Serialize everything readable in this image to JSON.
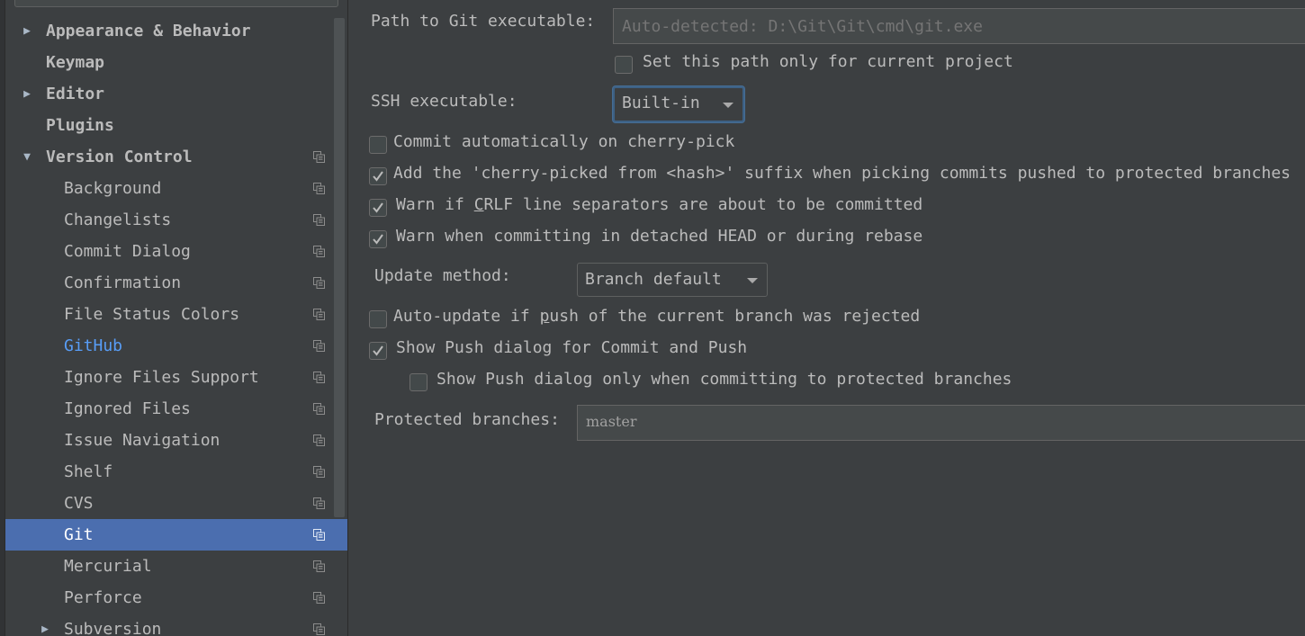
{
  "sidebar": {
    "items": [
      {
        "label": "Appearance & Behavior",
        "level": 0,
        "arrow": "right",
        "bold": true
      },
      {
        "label": "Keymap",
        "level": 0,
        "arrow": "",
        "bold": true
      },
      {
        "label": "Editor",
        "level": 0,
        "arrow": "right",
        "bold": true
      },
      {
        "label": "Plugins",
        "level": 0,
        "arrow": "",
        "bold": true
      },
      {
        "label": "Version Control",
        "level": 0,
        "arrow": "down",
        "bold": true,
        "project_icon": true
      },
      {
        "label": "Background",
        "level": 1,
        "project_icon": true
      },
      {
        "label": "Changelists",
        "level": 1,
        "project_icon": true
      },
      {
        "label": "Commit Dialog",
        "level": 1,
        "project_icon": true
      },
      {
        "label": "Confirmation",
        "level": 1,
        "project_icon": true
      },
      {
        "label": "File Status Colors",
        "level": 1,
        "project_icon": true
      },
      {
        "label": "GitHub",
        "level": 1,
        "project_icon": true,
        "link": true
      },
      {
        "label": "Ignore Files Support",
        "level": 1,
        "project_icon": true
      },
      {
        "label": "Ignored Files",
        "level": 1,
        "project_icon": true
      },
      {
        "label": "Issue Navigation",
        "level": 1,
        "project_icon": true
      },
      {
        "label": "Shelf",
        "level": 1,
        "project_icon": true
      },
      {
        "label": "CVS",
        "level": 1,
        "project_icon": true
      },
      {
        "label": "Git",
        "level": 1,
        "project_icon": true,
        "selected": true
      },
      {
        "label": "Mercurial",
        "level": 1,
        "project_icon": true
      },
      {
        "label": "Perforce",
        "level": 1,
        "project_icon": true
      },
      {
        "label": "Subversion",
        "level": 1,
        "arrow": "right",
        "project_icon": true
      }
    ]
  },
  "git_settings": {
    "path_label": "Path to Git executable:",
    "path_placeholder": "Auto-detected: D:\\Git\\Git\\cmd\\git.exe",
    "path_value": "",
    "set_path_project_only": {
      "label": "Set this path only for current project",
      "checked": false
    },
    "ssh_label": "SSH executable:",
    "ssh_value": "Built-in",
    "commit_auto_cherry_pick": {
      "label": "Commit automatically on cherry-pick",
      "checked": false
    },
    "cherry_picked_suffix": {
      "label": "Add the 'cherry-picked from <hash>' suffix when picking commits pushed to protected branches",
      "checked": true
    },
    "warn_crlf": {
      "label_pre": "Warn if ",
      "label_mn": "C",
      "label_post": "RLF line separators are about to be committed",
      "checked": true
    },
    "warn_detached": {
      "label": "Warn when committing in detached HEAD or during rebase",
      "checked": true
    },
    "update_method_label": "Update method:",
    "update_method_value": "Branch default",
    "auto_update_rejected": {
      "label_pre": "Auto-update if ",
      "label_mn": "p",
      "label_post": "ush of the current branch was rejected",
      "checked": false
    },
    "show_push_dialog": {
      "label": "Show Push dialog for Commit and Push",
      "checked": true
    },
    "show_push_protected_only": {
      "label": "Show Push dialog only when committing to protected branches",
      "checked": false
    },
    "protected_branches_label": "Protected branches:",
    "protected_branches_value": "master"
  },
  "colors": {
    "background": "#3c3f41",
    "selection": "#4b6eaf",
    "link": "#589df6",
    "text": "#bbbbbb",
    "focus_ring": "#3d6185"
  }
}
